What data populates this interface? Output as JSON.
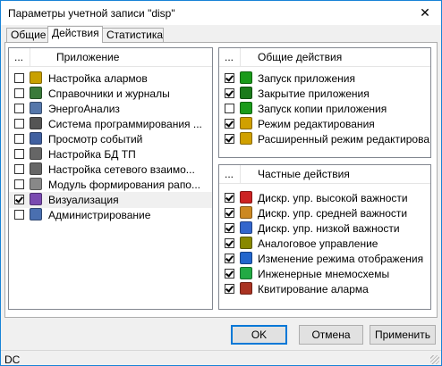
{
  "window": {
    "title": "Параметры учетной записи \"disp\"",
    "close_glyph": "✕"
  },
  "tabs": [
    {
      "label": "Общие"
    },
    {
      "label": "Действия"
    },
    {
      "label": "Статистика"
    }
  ],
  "apps": {
    "header_dots": "...",
    "header": "Приложение",
    "items": [
      {
        "label": "Настройка алармов",
        "checked": false,
        "icon": "alarm-speaker-icon",
        "color": "#c8a000"
      },
      {
        "label": "Справочники и журналы",
        "checked": false,
        "icon": "book-icon",
        "color": "#3a7a3a"
      },
      {
        "label": "ЭнергоАнализ",
        "checked": false,
        "icon": "energy-analysis-icon",
        "color": "#5577aa"
      },
      {
        "label": "Система программирования ...",
        "checked": false,
        "icon": "programming-icon",
        "color": "#555555"
      },
      {
        "label": "Просмотр событий",
        "checked": false,
        "icon": "events-icon",
        "color": "#4060a0"
      },
      {
        "label": "Настройка БД ТП",
        "checked": false,
        "icon": "database-icon",
        "color": "#666666"
      },
      {
        "label": "Настройка сетевого взаимо...",
        "checked": false,
        "icon": "network-icon",
        "color": "#666666"
      },
      {
        "label": "Модуль формирования рапо...",
        "checked": false,
        "icon": "report-icon",
        "color": "#888888"
      },
      {
        "label": "Визуализация",
        "checked": true,
        "icon": "visualization-icon",
        "color": "#7a4ab0"
      },
      {
        "label": "Администрирование",
        "checked": false,
        "icon": "admin-icon",
        "color": "#4a6fb0"
      }
    ]
  },
  "general": {
    "header_dots": "...",
    "header": "Общие действия",
    "items": [
      {
        "label": "Запуск приложения",
        "checked": true,
        "icon": "run-app-icon",
        "color": "#1a9a1a"
      },
      {
        "label": "Закрытие приложения",
        "checked": true,
        "icon": "close-app-icon",
        "color": "#1a7a1a"
      },
      {
        "label": "Запуск копии приложения",
        "checked": false,
        "icon": "run-copy-icon",
        "color": "#1a9a1a"
      },
      {
        "label": "Режим редактирования",
        "checked": true,
        "icon": "edit-mode-icon",
        "color": "#d0a000"
      },
      {
        "label": "Расширенный режим редактирова...",
        "checked": true,
        "icon": "ext-edit-mode-icon",
        "color": "#d0a000"
      }
    ]
  },
  "private": {
    "header_dots": "...",
    "header": "Частные действия",
    "items": [
      {
        "label": "Дискр. упр. высокой важности",
        "checked": true,
        "icon": "discrete-high-icon",
        "color": "#cc2222"
      },
      {
        "label": "Дискр. упр. средней важности",
        "checked": true,
        "icon": "discrete-mid-icon",
        "color": "#cc8822"
      },
      {
        "label": "Дискр. упр. низкой важности",
        "checked": true,
        "icon": "discrete-low-icon",
        "color": "#3366cc"
      },
      {
        "label": "Аналоговое управление",
        "checked": true,
        "icon": "analog-control-icon",
        "color": "#888800"
      },
      {
        "label": "Изменение режима отображения",
        "checked": true,
        "icon": "display-mode-icon",
        "color": "#2266cc"
      },
      {
        "label": "Инженерные мнемосхемы",
        "checked": true,
        "icon": "mnemo-icon",
        "color": "#22aa44"
      },
      {
        "label": "Квитирование аларма",
        "checked": true,
        "icon": "ack-alarm-icon",
        "color": "#aa3322"
      }
    ]
  },
  "buttons": {
    "ok": "OK",
    "cancel": "Отмена",
    "apply": "Применить"
  },
  "status": {
    "text": "DC"
  }
}
